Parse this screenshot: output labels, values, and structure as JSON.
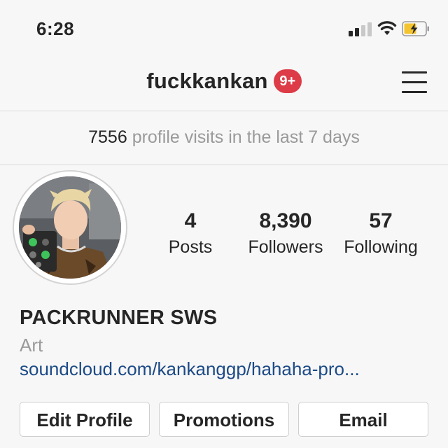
{
  "status_bar": {
    "time": "6:28",
    "signal_icon": "cellular-signal-icon",
    "wifi_icon": "wifi-icon",
    "battery_icon": "battery-charging-icon"
  },
  "header": {
    "username": "fuckkankan",
    "notification_badge": "9+",
    "menu_icon": "hamburger-menu-icon"
  },
  "insights": {
    "visit_count": "7556",
    "visit_text": "profile visits in the last 7 days"
  },
  "profile": {
    "stats": [
      {
        "value": "4",
        "label": "Posts"
      },
      {
        "value": "8,390",
        "label": "Followers"
      },
      {
        "value": "57",
        "label": "Following"
      }
    ],
    "full_name": "PACKRUNNER SWS",
    "category": "Art",
    "link": "soundcloud.com/kankanggp/hahaha-pro..."
  },
  "actions": {
    "edit_profile": "Edit Profile",
    "promotions": "Promotions",
    "email": "Email"
  },
  "colors": {
    "badge": "#dc3b47",
    "link": "#1c4a86",
    "muted_text": "#9a9a9a",
    "battery_charge": "#f4c430"
  }
}
